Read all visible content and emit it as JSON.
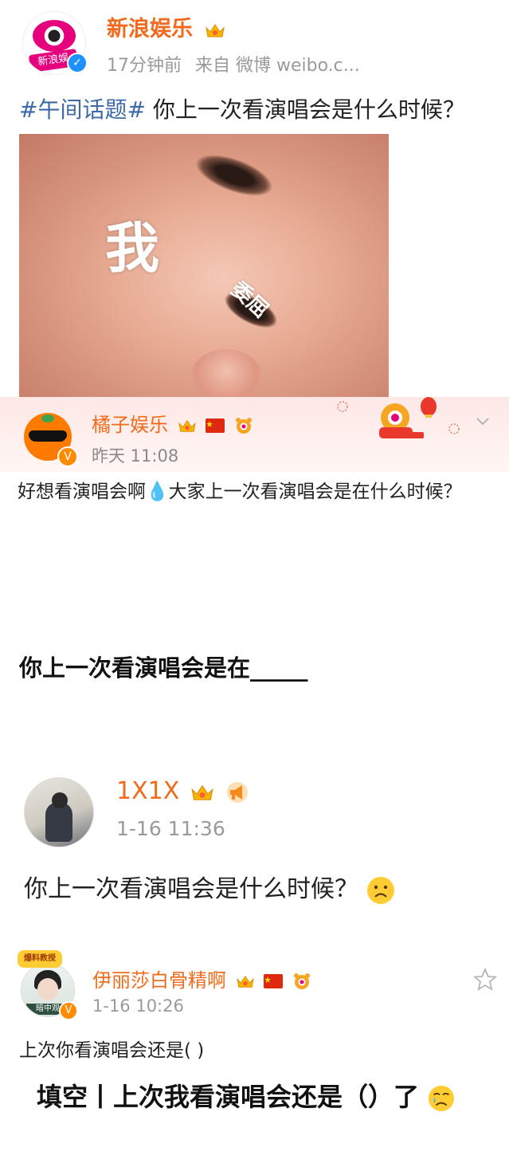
{
  "post1": {
    "author": "新浪娱乐",
    "avatar_label": "新浪娱",
    "meta_time": "17分钟前",
    "meta_source": "来自 微博 weibo.c...",
    "topic": "#午间话题#",
    "text": " 你上一次看演唱会是什么时候？",
    "image_text_1": "我",
    "image_text_2": "委屈"
  },
  "post2": {
    "author": "橘子娱乐",
    "time": "昨天 11:08",
    "text": "好想看演唱会啊💧大家上一次看演唱会是在什么时候？",
    "fill_blank": "你上一次看演唱会是在_____"
  },
  "post3": {
    "author": "1X1X",
    "time": "1-16 11:36",
    "text": "你上一次看演唱会是什么时候？"
  },
  "post4": {
    "author": "伊丽莎白骨精啊",
    "badge": "爆料教授",
    "avatar_label": "暗中观",
    "time": "1-16 10:26",
    "text": "上次你看演唱会还是( )",
    "big_text": "填空丨上次我看演唱会还是（）了"
  },
  "icons": {
    "verify_blue": "verified-blue-icon",
    "verify_orange": "verified-orange-icon",
    "crown": "crown-icon",
    "flag": "china-flag-icon",
    "fan": "fan-badge-icon",
    "megaphone": "megaphone-icon",
    "chevron": "chevron-down-icon",
    "star": "star-icon",
    "sad_face": "sad-face-emoji",
    "crying_face": "crying-face-emoji"
  },
  "colors": {
    "name_orange": "#f26a1b",
    "topic_blue": "#3d6aa6",
    "meta_gray": "#9a9a9a"
  }
}
